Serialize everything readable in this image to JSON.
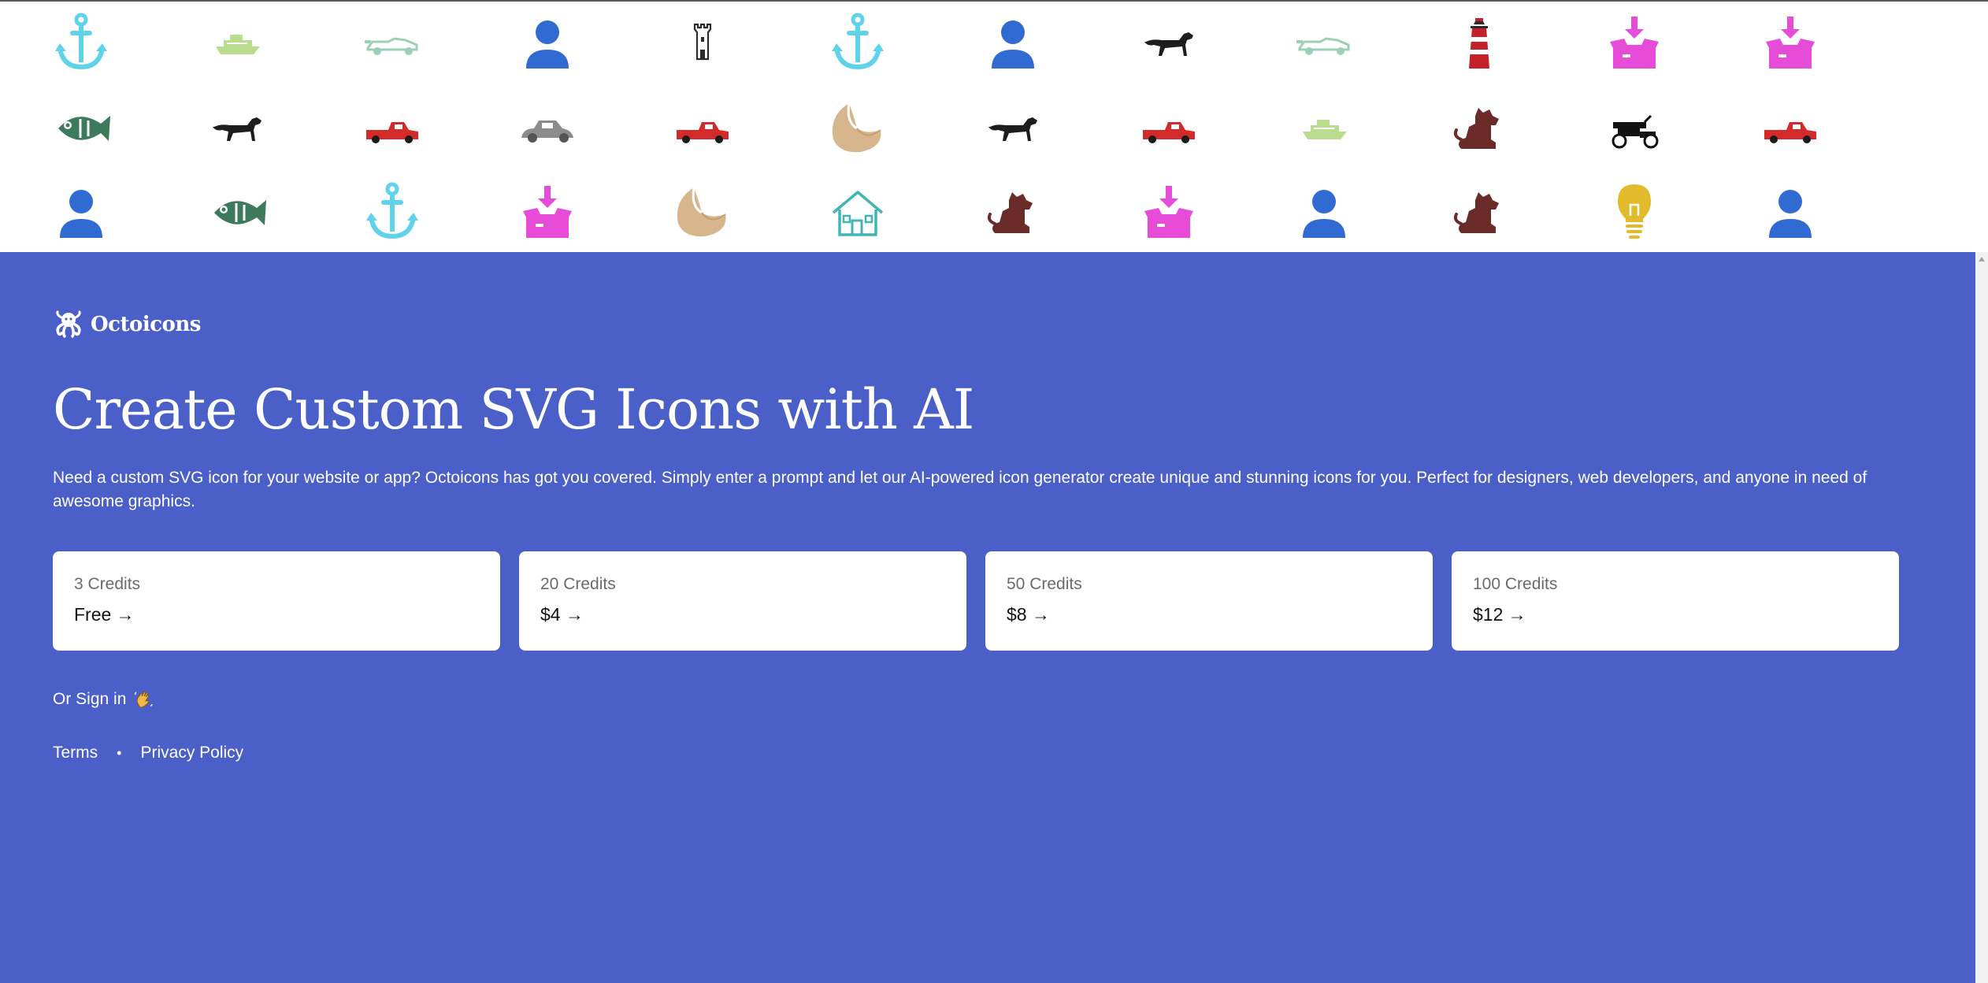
{
  "brand": {
    "name": "Octoicons"
  },
  "hero": {
    "headline": "Create Custom SVG Icons with AI",
    "description": "Need a custom SVG icon for your website or app? Octoicons has got you covered. Simply enter a prompt and let our AI-powered icon generator create unique and stunning icons for you. Perfect for designers, web developers, and anyone in need of awesome graphics."
  },
  "pricing": [
    {
      "credits": "3 Credits",
      "price": "Free →"
    },
    {
      "credits": "20 Credits",
      "price": "$4 →"
    },
    {
      "credits": "50 Credits",
      "price": "$8 →"
    },
    {
      "credits": "100 Credits",
      "price": "$12 →"
    }
  ],
  "signin": {
    "label": "Or Sign in"
  },
  "footer": {
    "terms": "Terms",
    "separator": "•",
    "privacy": "Privacy Policy"
  },
  "icon_strip": {
    "rows": [
      [
        "anchor-icon",
        "boat-icon",
        "race-car-icon",
        "user-icon",
        "castle-tower-icon",
        "anchor-icon",
        "user-icon",
        "hunting-dog-icon",
        "race-car-icon",
        "lighthouse-icon",
        "download-box-icon",
        "download-box-icon"
      ],
      [
        "fish-icon",
        "hunting-dog-icon",
        "pickup-truck-icon",
        "vintage-car-icon",
        "pickup-truck-icon",
        "croissant-icon",
        "hunting-dog-icon",
        "pickup-truck-icon",
        "boat-icon",
        "sitting-dog-icon",
        "antique-car-icon",
        "pickup-truck-icon"
      ],
      [
        "user-icon",
        "fish-icon",
        "anchor-icon",
        "download-box-icon",
        "croissant-icon",
        "house-icon",
        "sitting-dog-icon",
        "download-box-icon",
        "user-icon",
        "sitting-dog-icon",
        "lightbulb-icon",
        "user-icon"
      ]
    ]
  },
  "colors": {
    "hero_background": "#4a5fc8",
    "card_background": "#ffffff",
    "text_on_hero": "#ffffff",
    "anchor": "#5fd3ea",
    "boat": "#b9dc8f",
    "race_car": "#9bd1b2",
    "user": "#2f6bd0",
    "castle": "#2b2b2b",
    "dog": "#1d1d1d",
    "lighthouse": "#c3222b",
    "download_box": "#e64cd8",
    "fish": "#3d7a5c",
    "pickup": "#d42a2a",
    "vintage_car": "#8c8c8c",
    "croissant": "#d8b68d",
    "sitting_dog": "#6b2c29",
    "antique_car": "#111111",
    "house": "#41b5b5",
    "lightbulb": "#e2bb2c"
  }
}
